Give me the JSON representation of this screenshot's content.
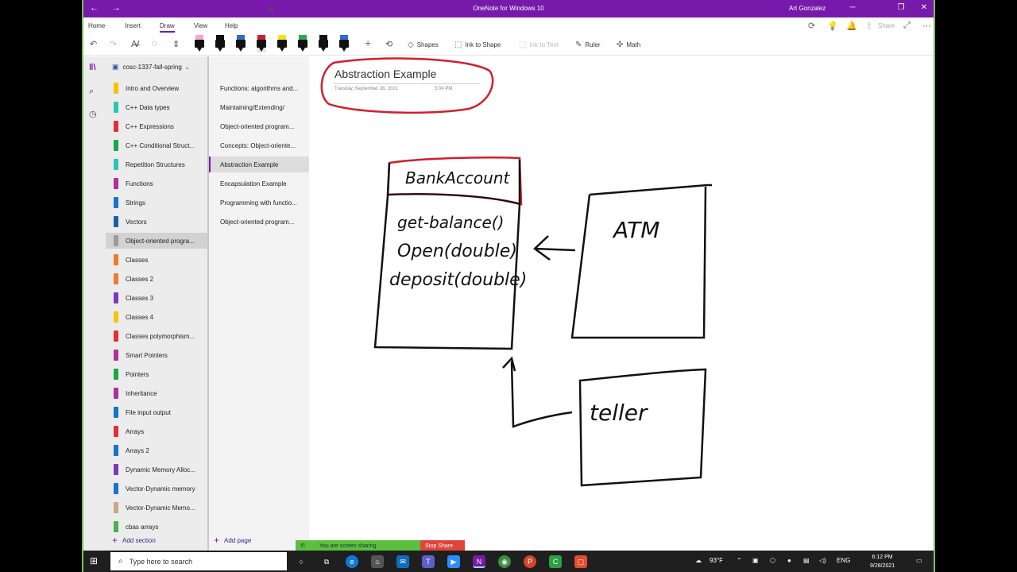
{
  "window": {
    "title": "OneNote for Windows 10",
    "user": "Art Gonzalez",
    "back": "←",
    "forward": "→",
    "minimize": "─",
    "restore": "❐",
    "close": "✕"
  },
  "menu": {
    "items": [
      "Home",
      "Insert",
      "Draw",
      "View",
      "Help"
    ],
    "active": "Draw",
    "share_label": "Share"
  },
  "ribbon": {
    "shapes_label": "Shapes",
    "ink_to_shape_label": "Ink to Shape",
    "ink_to_text_label": "Ink to Text",
    "ruler_label": "Ruler",
    "math_label": "Math",
    "pen_colors": [
      "#f0a8d0",
      "#111111",
      "#2b6fcf",
      "#d11f2c",
      "#f5e31a",
      "#2ba84a",
      "#111111",
      "#2b6fcf"
    ]
  },
  "notebook": {
    "name": "cosc-1337-fall-spring"
  },
  "sections": [
    {
      "label": "Intro and Overview",
      "color": "#f5c400"
    },
    {
      "label": "C++ Data types",
      "color": "#2ec4b6"
    },
    {
      "label": "C++ Expressions",
      "color": "#e0303a"
    },
    {
      "label": "C++ Conditional Struct...",
      "color": "#1aa84a"
    },
    {
      "label": "Repetition Structures",
      "color": "#2ec4b6"
    },
    {
      "label": "Functions",
      "color": "#b0309a"
    },
    {
      "label": "Strings",
      "color": "#1a73c9"
    },
    {
      "label": "Vectors",
      "color": "#1a5fa8"
    },
    {
      "label": "Object-oriented progra...",
      "color": "#9a9a9a"
    },
    {
      "label": "Classes",
      "color": "#f07b2a"
    },
    {
      "label": "Classes 2",
      "color": "#f07b2a"
    },
    {
      "label": "Classes 3",
      "color": "#7a3ab8"
    },
    {
      "label": "Classes 4",
      "color": "#f5c400"
    },
    {
      "label": "Classes polymorphism...",
      "color": "#e0303a"
    },
    {
      "label": "Smart Pointers",
      "color": "#b0309a"
    },
    {
      "label": "Pointers",
      "color": "#1aa84a"
    },
    {
      "label": "Inheritance",
      "color": "#b0309a"
    },
    {
      "label": "File input output",
      "color": "#1a73c9"
    },
    {
      "label": "Arrays",
      "color": "#e0303a"
    },
    {
      "label": "Arrays 2",
      "color": "#1a73c9"
    },
    {
      "label": "Dynamic Memory Alloc...",
      "color": "#7a3ab8"
    },
    {
      "label": "Vector-Dynamic memory",
      "color": "#1a73c9"
    },
    {
      "label": "Vector-Dynamic Memo...",
      "color": "#c9a882"
    },
    {
      "label": "cbas arrays",
      "color": "#4caf50"
    }
  ],
  "selected_section": 8,
  "pages": [
    {
      "label": "Functions: algorithms and..."
    },
    {
      "label": "Maintaining/Extending/"
    },
    {
      "label": "Object-oriented program..."
    },
    {
      "label": "Concepts: Object-oriente..."
    },
    {
      "label": "Abstraction Example"
    },
    {
      "label": "Encapsulation Example"
    },
    {
      "label": "Programming with functio..."
    },
    {
      "label": "Object-oriented program..."
    }
  ],
  "selected_page": 4,
  "add_section_label": "Add section",
  "add_page_label": "Add page",
  "page": {
    "title": "Abstraction Example",
    "date": "Tuesday, September 28, 2021",
    "time": "5:04 PM"
  },
  "ink": {
    "class_name": "BankAccount",
    "methods": [
      "get-balance()",
      "Open(double)",
      "deposit(double)"
    ],
    "atm_label": "ATM",
    "teller_label": "teller"
  },
  "screen_share": {
    "status": "You are screen sharing",
    "stop": "Stop Share"
  },
  "taskbar": {
    "search_placeholder": "Type here to search",
    "weather": "93°F",
    "language": "ENG",
    "time": "6:12 PM",
    "date": "9/28/2021"
  }
}
